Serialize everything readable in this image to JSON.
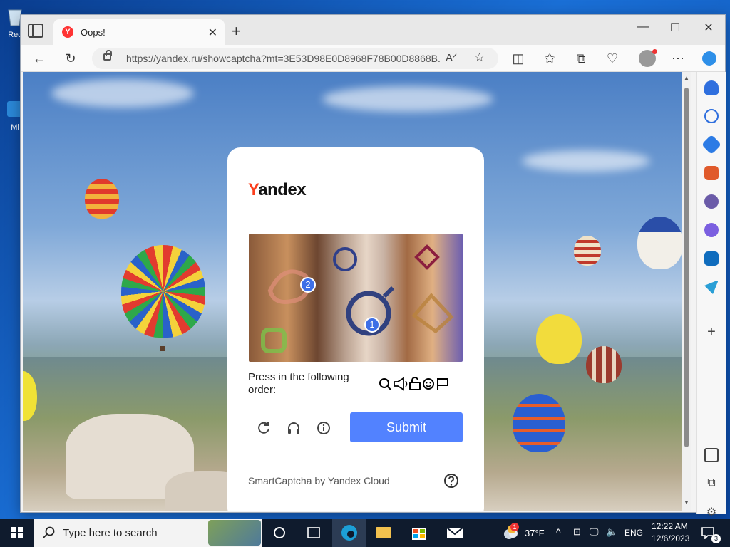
{
  "desktop": {
    "icons": [
      {
        "label": "Rec",
        "name": "recycle-bin"
      },
      {
        "label": "Mi",
        "name": "edge"
      }
    ]
  },
  "browser": {
    "tab": {
      "title": "Oops!",
      "favicon_letter": "Y"
    },
    "address": {
      "url": "https://yandex.ru/showcaptcha?mt=3E53D98E0D8968F78B00D8868B..."
    }
  },
  "captcha": {
    "logo_first": "Y",
    "logo_rest": "andex",
    "markers": [
      "2",
      "1"
    ],
    "instruction": "Press in the following order:",
    "order_icons": [
      "search-icon",
      "megaphone-icon",
      "unlock-icon",
      "smiley-icon",
      "flag-icon"
    ],
    "submit_label": "Submit",
    "footer": "SmartCaptcha by Yandex Cloud"
  },
  "taskbar": {
    "search_placeholder": "Type here to search",
    "weather": "37°F",
    "weather_badge": "1",
    "language": "ENG",
    "time": "12:22 AM",
    "date": "12/6/2023",
    "notifications": "3"
  },
  "colors": {
    "accent": "#5282ff",
    "yandex_red": "#fc3f1d",
    "marker_blue": "#3e6fe6"
  }
}
